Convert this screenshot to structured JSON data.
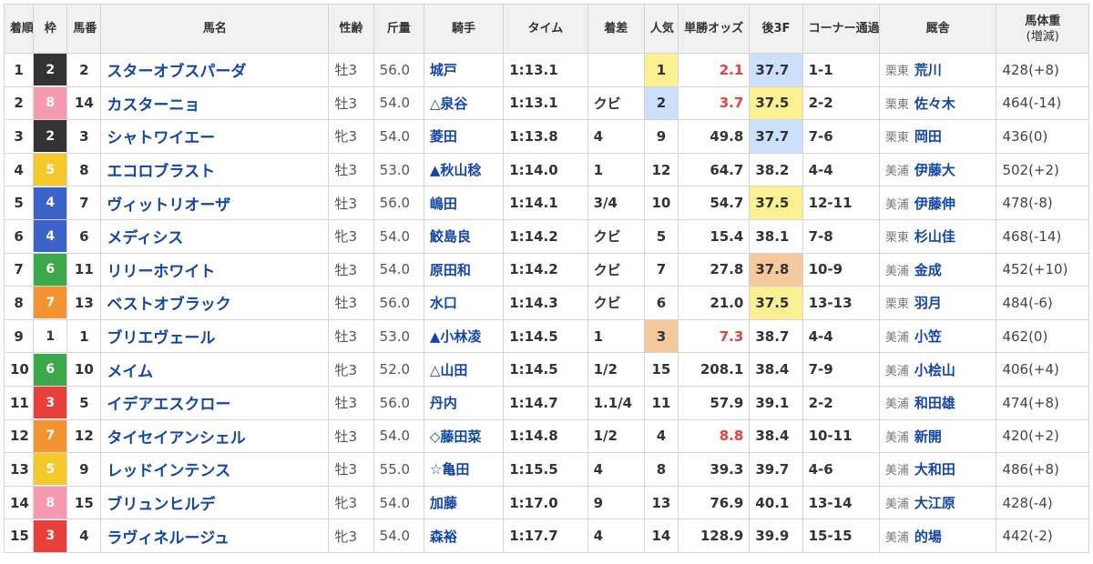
{
  "headers": {
    "rank": "着順",
    "waku": "枠",
    "umaban": "馬番",
    "name": "馬名",
    "sexage": "性齢",
    "kinryo": "斤量",
    "jockey": "騎手",
    "time": "タイム",
    "margin": "着差",
    "pop": "人気",
    "odds": "単勝オッズ",
    "last3f": "後3F",
    "corner": "コーナー通過順",
    "trainer": "厩舎",
    "weight": "馬体重",
    "weight_sub": "(増減)"
  },
  "rows": [
    {
      "rank": "1",
      "waku": "2",
      "umaban": "2",
      "name": "スターオブスパーダ",
      "sexage": "牡3",
      "kinryo": "56.0",
      "jockey": "城戸",
      "time": "1:13.1",
      "margin": "",
      "pop": "1",
      "odds": "2.1",
      "last3f": "37.7",
      "corner": "1-1",
      "loc": "栗東",
      "trainer": "荒川",
      "weight": "428(+8)",
      "pop_hl": "y",
      "odds_red": true,
      "f3_hl": "b"
    },
    {
      "rank": "2",
      "waku": "8",
      "umaban": "14",
      "name": "カスターニョ",
      "sexage": "牡3",
      "kinryo": "54.0",
      "jockey": "△泉谷",
      "time": "1:13.1",
      "margin": "クビ",
      "pop": "2",
      "odds": "3.7",
      "last3f": "37.5",
      "corner": "2-2",
      "loc": "栗東",
      "trainer": "佐々木",
      "weight": "464(-14)",
      "pop_hl": "b",
      "odds_red": true,
      "f3_hl": "y"
    },
    {
      "rank": "3",
      "waku": "2",
      "umaban": "3",
      "name": "シャトワイエー",
      "sexage": "牝3",
      "kinryo": "54.0",
      "jockey": "菱田",
      "time": "1:13.8",
      "margin": "4",
      "pop": "9",
      "odds": "49.8",
      "last3f": "37.7",
      "corner": "7-6",
      "loc": "栗東",
      "trainer": "岡田",
      "weight": "436(0)",
      "pop_hl": "",
      "odds_red": false,
      "f3_hl": "b"
    },
    {
      "rank": "4",
      "waku": "5",
      "umaban": "8",
      "name": "エコロブラスト",
      "sexage": "牡3",
      "kinryo": "53.0",
      "jockey": "▲秋山稔",
      "time": "1:14.0",
      "margin": "1",
      "pop": "12",
      "odds": "64.7",
      "last3f": "38.2",
      "corner": "4-4",
      "loc": "美浦",
      "trainer": "伊藤大",
      "weight": "502(+2)",
      "pop_hl": "",
      "odds_red": false,
      "f3_hl": ""
    },
    {
      "rank": "5",
      "waku": "4",
      "umaban": "7",
      "name": "ヴィットリオーザ",
      "sexage": "牡3",
      "kinryo": "56.0",
      "jockey": "嶋田",
      "time": "1:14.1",
      "margin": "3/4",
      "pop": "10",
      "odds": "54.7",
      "last3f": "37.5",
      "corner": "12-11",
      "loc": "美浦",
      "trainer": "伊藤伸",
      "weight": "478(-8)",
      "pop_hl": "",
      "odds_red": false,
      "f3_hl": "y"
    },
    {
      "rank": "6",
      "waku": "4",
      "umaban": "6",
      "name": "メディシス",
      "sexage": "牝3",
      "kinryo": "54.0",
      "jockey": "鮫島良",
      "time": "1:14.2",
      "margin": "クビ",
      "pop": "5",
      "odds": "15.4",
      "last3f": "38.1",
      "corner": "7-8",
      "loc": "栗東",
      "trainer": "杉山佳",
      "weight": "468(-14)",
      "pop_hl": "",
      "odds_red": false,
      "f3_hl": ""
    },
    {
      "rank": "7",
      "waku": "6",
      "umaban": "11",
      "name": "リリーホワイト",
      "sexage": "牡3",
      "kinryo": "54.0",
      "jockey": "原田和",
      "time": "1:14.2",
      "margin": "クビ",
      "pop": "7",
      "odds": "27.8",
      "last3f": "37.8",
      "corner": "10-9",
      "loc": "美浦",
      "trainer": "金成",
      "weight": "452(+10)",
      "pop_hl": "",
      "odds_red": false,
      "f3_hl": "o"
    },
    {
      "rank": "8",
      "waku": "7",
      "umaban": "13",
      "name": "ベストオブラック",
      "sexage": "牡3",
      "kinryo": "56.0",
      "jockey": "水口",
      "time": "1:14.3",
      "margin": "クビ",
      "pop": "6",
      "odds": "21.0",
      "last3f": "37.5",
      "corner": "13-13",
      "loc": "栗東",
      "trainer": "羽月",
      "weight": "484(-6)",
      "pop_hl": "",
      "odds_red": false,
      "f3_hl": "y"
    },
    {
      "rank": "9",
      "waku": "1",
      "umaban": "1",
      "name": "ブリエヴェール",
      "sexage": "牡3",
      "kinryo": "53.0",
      "jockey": "▲小林凌",
      "time": "1:14.5",
      "margin": "1",
      "pop": "3",
      "odds": "7.3",
      "last3f": "38.7",
      "corner": "4-4",
      "loc": "美浦",
      "trainer": "小笠",
      "weight": "462(0)",
      "pop_hl": "o",
      "odds_red": true,
      "f3_hl": ""
    },
    {
      "rank": "10",
      "waku": "6",
      "umaban": "10",
      "name": "メイム",
      "sexage": "牝3",
      "kinryo": "52.0",
      "jockey": "△山田",
      "time": "1:14.5",
      "margin": "1/2",
      "pop": "15",
      "odds": "208.1",
      "last3f": "38.4",
      "corner": "7-9",
      "loc": "美浦",
      "trainer": "小桧山",
      "weight": "406(+4)",
      "pop_hl": "",
      "odds_red": false,
      "f3_hl": ""
    },
    {
      "rank": "11",
      "waku": "3",
      "umaban": "5",
      "name": "イデアエスクロー",
      "sexage": "牡3",
      "kinryo": "56.0",
      "jockey": "丹内",
      "time": "1:14.7",
      "margin": "1.1/4",
      "pop": "11",
      "odds": "57.9",
      "last3f": "39.1",
      "corner": "2-2",
      "loc": "美浦",
      "trainer": "和田雄",
      "weight": "474(+8)",
      "pop_hl": "",
      "odds_red": false,
      "f3_hl": ""
    },
    {
      "rank": "12",
      "waku": "7",
      "umaban": "12",
      "name": "タイセイアンシェル",
      "sexage": "牡3",
      "kinryo": "54.0",
      "jockey": "◇藤田菜",
      "time": "1:14.8",
      "margin": "1/2",
      "pop": "4",
      "odds": "8.8",
      "last3f": "38.4",
      "corner": "10-11",
      "loc": "美浦",
      "trainer": "新開",
      "weight": "420(+2)",
      "pop_hl": "",
      "odds_red": true,
      "f3_hl": ""
    },
    {
      "rank": "13",
      "waku": "5",
      "umaban": "9",
      "name": "レッドインテンス",
      "sexage": "牡3",
      "kinryo": "55.0",
      "jockey": "☆亀田",
      "time": "1:15.5",
      "margin": "4",
      "pop": "8",
      "odds": "39.3",
      "last3f": "39.7",
      "corner": "4-6",
      "loc": "美浦",
      "trainer": "大和田",
      "weight": "486(+8)",
      "pop_hl": "",
      "odds_red": false,
      "f3_hl": ""
    },
    {
      "rank": "14",
      "waku": "8",
      "umaban": "15",
      "name": "ブリュンヒルデ",
      "sexage": "牝3",
      "kinryo": "54.0",
      "jockey": "加藤",
      "time": "1:17.0",
      "margin": "9",
      "pop": "13",
      "odds": "76.9",
      "last3f": "40.1",
      "corner": "13-14",
      "loc": "美浦",
      "trainer": "大江原",
      "weight": "428(-4)",
      "pop_hl": "",
      "odds_red": false,
      "f3_hl": ""
    },
    {
      "rank": "15",
      "waku": "3",
      "umaban": "4",
      "name": "ラヴィネルージュ",
      "sexage": "牝3",
      "kinryo": "54.0",
      "jockey": "森裕",
      "time": "1:17.7",
      "margin": "4",
      "pop": "14",
      "odds": "128.9",
      "last3f": "39.9",
      "corner": "15-15",
      "loc": "美浦",
      "trainer": "的場",
      "weight": "442(-2)",
      "pop_hl": "",
      "odds_red": false,
      "f3_hl": ""
    }
  ]
}
